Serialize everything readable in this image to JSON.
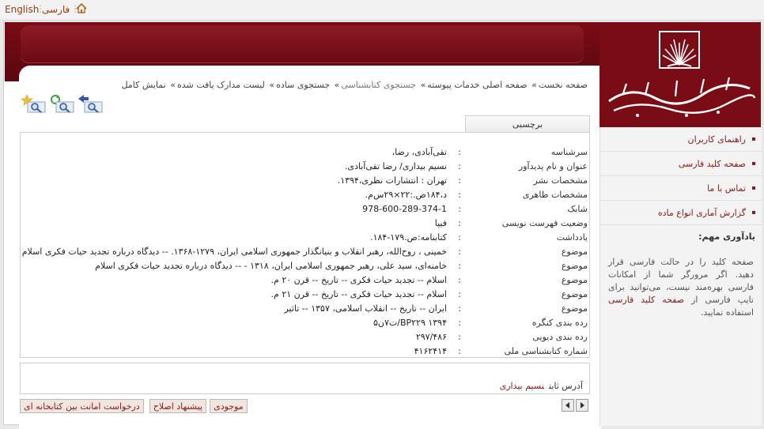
{
  "topbar": {
    "english": "English",
    "farsi": "فارسی"
  },
  "breadcrumb": [
    "صفحه نخست",
    "صفحه اصلی خدمات پیوسته",
    "جستجوی کتابشناسی",
    "جستجوی ساده",
    "لیست مدارک یافت شده",
    "نمایش کامل"
  ],
  "tab": {
    "label": "برچسبی"
  },
  "record": [
    {
      "label": "سرشناسه",
      "value": "تقی‌آبادی، رضا،"
    },
    {
      "label": "عنوان و نام پدیدآور",
      "value": "نسیم بیداری/ رضا تقی‌آبادی."
    },
    {
      "label": "مشخصات نشر",
      "value": "تهران : انتشارات نظری،۱۳۹۴."
    },
    {
      "label": "مشخصات ظاهری",
      "value": "د،۱۸۴ص.:۲۲×۲۹س‌م."
    },
    {
      "label": "شابک",
      "value": "978-600-289-374-1"
    },
    {
      "label": "وضعیت فهرست نویسی",
      "value": "فیپا"
    },
    {
      "label": "یادداشت",
      "value": "کتابنامه:ص.۱۷۹-۱۸۴."
    },
    {
      "label": "موضوع",
      "value": "خمینی ، روح‌الله، رهبر انقلاب و بنیانگذار جمهوری اسلامی ایران، ۱۲۷۹-۱۳۶۸. -- دیدگاه درباره تجدید حیات فکری اسلام"
    },
    {
      "label": "موضوع",
      "value": "خامنه‌ای، سید علی، رهبر جمهوری اسلامی ایران، ۱۳۱۸ - -- دیدگاه درباره تجدید حیات فکری اسلام"
    },
    {
      "label": "موضوع",
      "value": "اسلام -- تجدید حیات فکری -- تاریخ -- قرن ۲۰ م."
    },
    {
      "label": "موضوع",
      "value": "اسلام -- تجدید حیات فکری -- تاریخ -- قرن ۲۱ م."
    },
    {
      "label": "موضوع",
      "value": "ایران -- تاریخ -- انقلاب اسلامی، ۱۳۵۷ -- تاثیر"
    },
    {
      "label": "رده بندی کنگره",
      "value": "۱۳۹۴ BP۲۲۹/ت۷ن۵"
    },
    {
      "label": "رده بندی دیویی",
      "value": "۲۹۷/۴۸۶"
    },
    {
      "label": "شماره کتابشناسی ملی",
      "value": "۴۱۶۲۴۱۴"
    }
  ],
  "fixed_address": {
    "label": "آدرس ثابت",
    "link": "نسیم بیداری"
  },
  "buttons": {
    "availability": "موجودی",
    "suggest": "پیشنهاد اصلاح",
    "request": "درخواست امانت بین کتابخانه ای"
  },
  "sidebar": {
    "items": [
      "راهنمای کاربران",
      "صفحه کلید فارسی",
      "تماس با ما",
      "گزارش آماری انواع ماده"
    ],
    "reminder_title": "یادآوری مهم:",
    "reminder_text_1": "صفحه کلید را در حالت فارسی قرار دهید. اگر مرورگر شما از امکانات فارسی بهره‌مند نیست، می‌توانید برای تایپ فارسی از ",
    "reminder_link": "صفحه کلید فارسی",
    "reminder_text_2": " استفاده نمایید."
  },
  "colors": {
    "brand": "#7a0c16",
    "link": "#8b1a1a"
  },
  "icons": [
    "home-icon",
    "zoom-star-icon",
    "zoom-refresh-icon",
    "zoom-back-icon",
    "arrow-left-icon",
    "arrow-right-icon"
  ]
}
